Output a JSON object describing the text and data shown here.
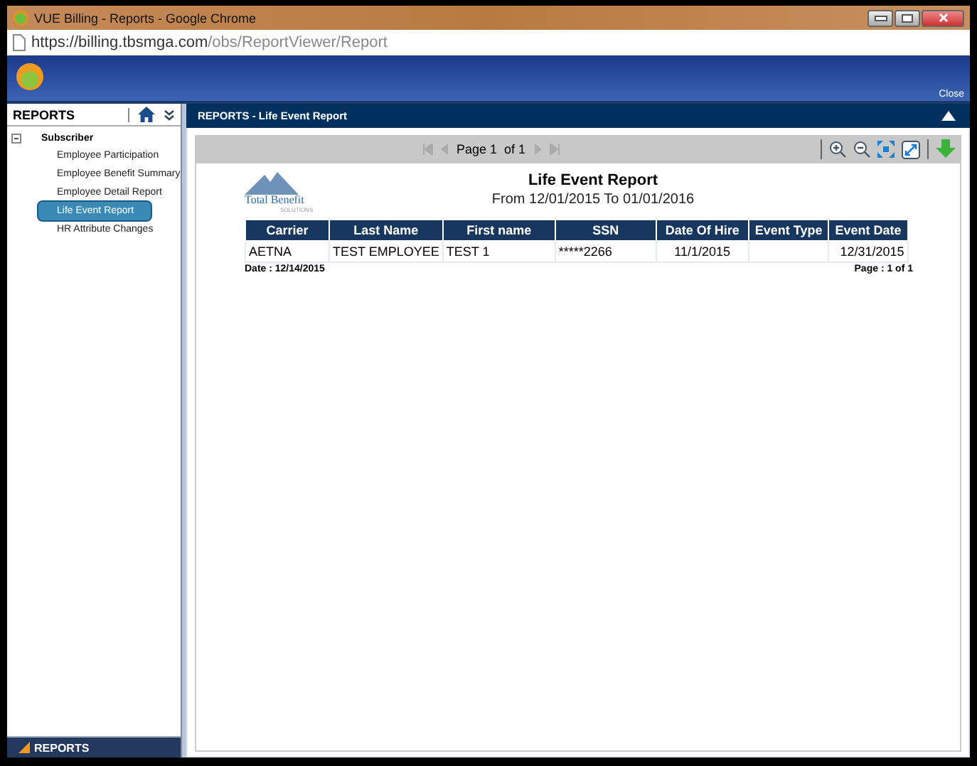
{
  "window": {
    "title": "VUE Billing - Reports - Google Chrome",
    "url_host": "https://billing.tbsmga.com",
    "url_path": "/obs/ReportViewer/Report"
  },
  "header": {
    "close": "Close"
  },
  "sidebar": {
    "title": "REPORTS",
    "items": [
      {
        "label": "Subscriber",
        "expanded": true,
        "children": [
          {
            "label": "Employee Participation",
            "selected": false
          },
          {
            "label": "Employee Benefit Summary",
            "selected": false
          },
          {
            "label": "Employee Detail Report",
            "selected": false
          },
          {
            "label": "Life Event Report",
            "selected": true
          },
          {
            "label": "HR Attribute Changes",
            "selected": false
          }
        ]
      }
    ],
    "footer": "REPORTS"
  },
  "panel": {
    "title": "REPORTS - Life Event Report"
  },
  "toolbar": {
    "page": "Page 1",
    "of": "of 1"
  },
  "report": {
    "logo": "Total Benefit",
    "logo_sub": "SOLUTIONS",
    "title": "Life Event Report",
    "subtitle": "From 12/01/2015 To 01/01/2016",
    "table": {
      "columns": [
        "Carrier",
        "Last Name",
        "First name",
        "SSN",
        "Date Of Hire",
        "Event Type",
        "Event Date"
      ],
      "rows": [
        [
          "AETNA",
          "TEST EMPLOYEE",
          "TEST 1",
          "*****2266",
          "11/1/2015",
          "",
          "12/31/2015"
        ]
      ]
    },
    "date": "Date : 12/14/2015",
    "pages": "Page : 1 of 1"
  }
}
